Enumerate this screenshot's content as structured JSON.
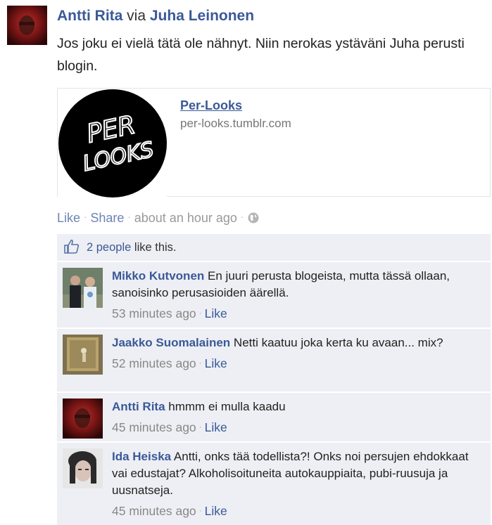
{
  "post": {
    "author": "Antti Rita",
    "via_word": "via",
    "via_author": "Juha Leinonen",
    "message": "Jos joku ei vielä tätä ole nähnyt. Niin nerokas ystäväni Juha perusti blogin.",
    "link": {
      "title": "Per-Looks",
      "url": "per-looks.tumblr.com",
      "logo_line1": "PER",
      "logo_line2": "LOOKS"
    },
    "actions": {
      "like": "Like",
      "share": "Share",
      "time": "about an hour ago",
      "privacy_icon": "globe-icon"
    }
  },
  "likes": {
    "count_link": "2 people",
    "suffix": "like this."
  },
  "comments": [
    {
      "author": "Mikko Kutvonen",
      "text": "En juuri perusta blogeista, mutta tässä ollaan, sanoisinko perusasioiden äärellä.",
      "time": "53 minutes ago",
      "like": "Like"
    },
    {
      "author": "Jaakko Suomalainen",
      "text": "Netti kaatuu joka kerta ku avaan... mix?",
      "time": "52 minutes ago",
      "like": "Like"
    },
    {
      "author": "Antti Rita",
      "text": "hmmm ei mulla kaadu",
      "time": "45 minutes ago",
      "like": "Like"
    },
    {
      "author": "Ida Heiska",
      "text": "Antti, onks tää todellista?! Onks noi persujen ehdokkaat vai edustajat? Alkoholisoituneita autokauppiaita, pubi-ruusuja ja uusnatseja.",
      "time": "45 minutes ago",
      "like": "Like"
    }
  ],
  "colors": {
    "link": "#3b5998",
    "comment_bg": "#edeff4",
    "meta": "#888888"
  }
}
